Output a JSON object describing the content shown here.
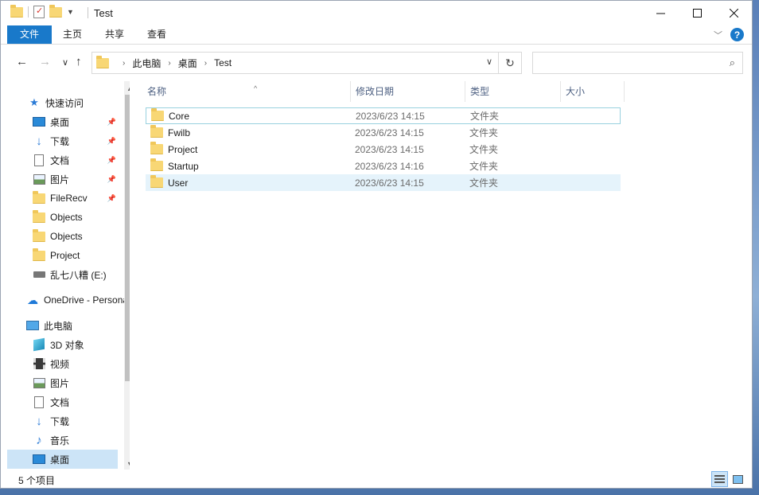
{
  "window": {
    "title": "Test"
  },
  "ribbon": {
    "tabs": [
      "文件",
      "主页",
      "共享",
      "查看"
    ]
  },
  "address": {
    "crumbs": [
      "此电脑",
      "桌面",
      "Test"
    ]
  },
  "search": {
    "placeholder": "",
    "value": ""
  },
  "sidebar": {
    "items": [
      {
        "label": "快速访问",
        "icon": "star-icon",
        "pinned": false
      },
      {
        "label": "桌面",
        "icon": "desktop-icon",
        "pinned": true
      },
      {
        "label": "下载",
        "icon": "download-icon",
        "pinned": true
      },
      {
        "label": "文档",
        "icon": "document-icon",
        "pinned": true
      },
      {
        "label": "图片",
        "icon": "picture-icon",
        "pinned": true
      },
      {
        "label": "FileRecv",
        "icon": "folder-icon",
        "pinned": true
      },
      {
        "label": "Objects",
        "icon": "folder-icon",
        "pinned": false
      },
      {
        "label": "Objects",
        "icon": "folder-icon",
        "pinned": false
      },
      {
        "label": "Project",
        "icon": "folder-icon",
        "pinned": false
      },
      {
        "label": "乱七八糟 (E:)",
        "icon": "drive-icon",
        "pinned": false
      },
      {
        "label": "OneDrive - Personal",
        "icon": "onedrive-cloud-icon",
        "pinned": false
      },
      {
        "label": "此电脑",
        "icon": "this-pc-icon",
        "pinned": false
      },
      {
        "label": "3D 对象",
        "icon": "3d-objects-icon",
        "pinned": false
      },
      {
        "label": "视频",
        "icon": "video-icon",
        "pinned": false
      },
      {
        "label": "图片",
        "icon": "picture-icon",
        "pinned": false
      },
      {
        "label": "文档",
        "icon": "document-icon",
        "pinned": false
      },
      {
        "label": "下载",
        "icon": "download-icon",
        "pinned": false
      },
      {
        "label": "音乐",
        "icon": "music-icon",
        "pinned": false
      },
      {
        "label": "桌面",
        "icon": "desktop-icon",
        "pinned": false,
        "selected": true
      }
    ]
  },
  "filelist": {
    "columns": [
      "名称",
      "修改日期",
      "类型",
      "大小"
    ],
    "rows": [
      {
        "name": "Core",
        "modified": "2023/6/23 14:15",
        "type": "文件夹",
        "size": ""
      },
      {
        "name": "Fwilb",
        "modified": "2023/6/23 14:15",
        "type": "文件夹",
        "size": ""
      },
      {
        "name": "Project",
        "modified": "2023/6/23 14:15",
        "type": "文件夹",
        "size": ""
      },
      {
        "name": "Startup",
        "modified": "2023/6/23 14:16",
        "type": "文件夹",
        "size": ""
      },
      {
        "name": "User",
        "modified": "2023/6/23 14:15",
        "type": "文件夹",
        "size": ""
      }
    ]
  },
  "status": {
    "item_count": "5 个项目"
  },
  "colors": {
    "accent": "#1979ca",
    "selection": "#cce4f7",
    "hover": "#e5f3fb",
    "folder": "#f8d775"
  }
}
